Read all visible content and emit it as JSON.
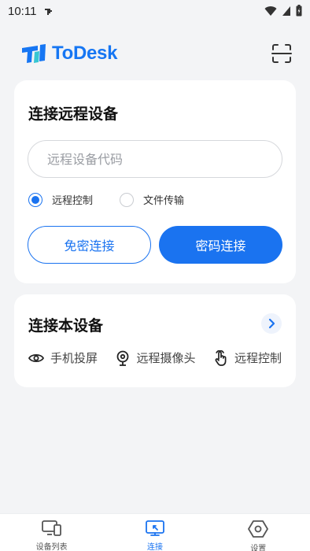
{
  "status_bar": {
    "time": "10:11",
    "icons": [
      "notification-icon",
      "wifi-icon",
      "signal-icon",
      "battery-icon"
    ]
  },
  "header": {
    "brand": "ToDesk",
    "brand_color": "#1676f3",
    "scan_icon": "scan-icon"
  },
  "remote_card": {
    "title": "连接远程设备",
    "code_input": {
      "placeholder": "远程设备代码",
      "value": ""
    },
    "modes": [
      {
        "label": "远程控制",
        "selected": true
      },
      {
        "label": "文件传输",
        "selected": false
      }
    ],
    "passwordless_button": "免密连接",
    "password_button": "密码连接"
  },
  "local_card": {
    "title": "连接本设备",
    "features": [
      {
        "icon": "eye-icon",
        "label": "手机投屏"
      },
      {
        "icon": "webcam-icon",
        "label": "远程摄像头"
      },
      {
        "icon": "hand-pointer-icon",
        "label": "远程控制"
      }
    ]
  },
  "tabs": [
    {
      "icon": "devices-icon",
      "label": "设备列表",
      "active": false
    },
    {
      "icon": "connect-icon",
      "label": "连接",
      "active": true
    },
    {
      "icon": "settings-icon",
      "label": "设置",
      "active": false
    }
  ],
  "colors": {
    "accent": "#1a73f0",
    "background": "#f3f4f6",
    "card": "#ffffff"
  }
}
